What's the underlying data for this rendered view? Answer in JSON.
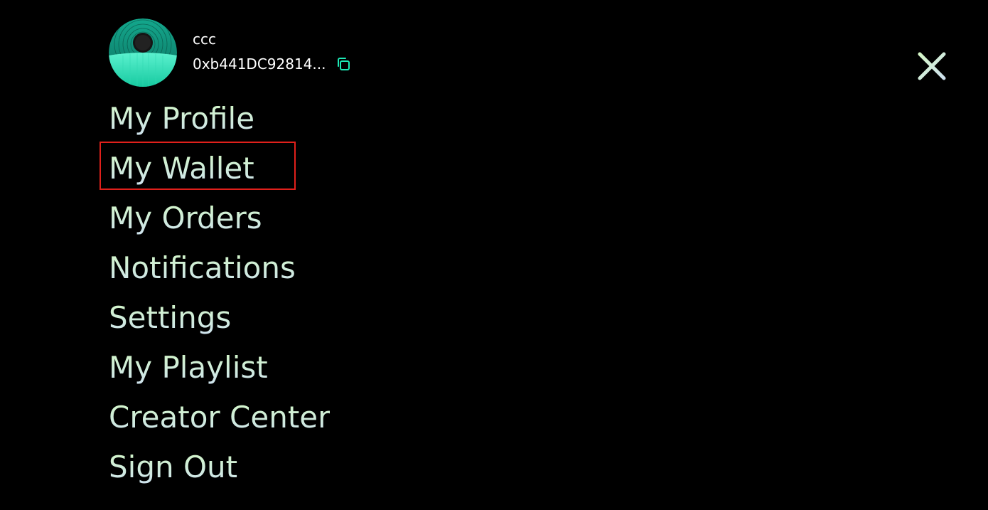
{
  "user": {
    "name": "ccc",
    "address": "0xb441DC92814...",
    "avatar_icon": "avatar-orb",
    "copy_icon": "copy-icon"
  },
  "menu": {
    "items": [
      {
        "label": "My Profile"
      },
      {
        "label": "My Wallet",
        "highlighted": true
      },
      {
        "label": "My Orders"
      },
      {
        "label": "Notifications"
      },
      {
        "label": "Settings"
      },
      {
        "label": "My Playlist"
      },
      {
        "label": "Creator Center"
      },
      {
        "label": "Sign Out"
      }
    ]
  },
  "close_icon": "close-icon",
  "colors": {
    "background": "#000000",
    "accent": "#1de9b6",
    "menu_text_top": "#d2f7c5",
    "menu_text_bottom": "#cfe3ef",
    "highlight": "#e0201b"
  }
}
